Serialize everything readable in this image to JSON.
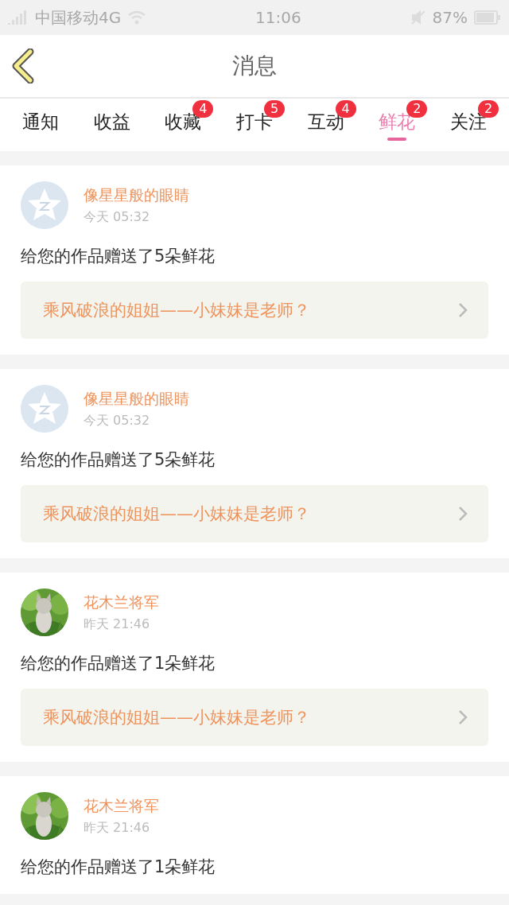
{
  "status_bar": {
    "carrier": "中国移动4G",
    "time": "11:06",
    "battery": "87%"
  },
  "header": {
    "title": "消息"
  },
  "tabs": [
    {
      "label": "通知",
      "selected": false
    },
    {
      "label": "收益",
      "selected": false
    },
    {
      "label": "收藏",
      "selected": false,
      "badge": "4"
    },
    {
      "label": "打卡",
      "selected": false,
      "badge": "5"
    },
    {
      "label": "互动",
      "selected": false,
      "badge": "4"
    },
    {
      "label": "鲜花",
      "selected": true,
      "badge": "2"
    },
    {
      "label": "关注",
      "selected": false,
      "badge": "2"
    }
  ],
  "messages": [
    {
      "kind": "default",
      "name": "像星星般的眼睛",
      "time": "今天 05:32",
      "text": "给您的作品赠送了5朵鲜花",
      "link": "乘风破浪的姐姐——小妹妹是老师？"
    },
    {
      "kind": "default",
      "name": "像星星般的眼睛",
      "time": "今天 05:32",
      "text": "给您的作品赠送了5朵鲜花",
      "link": "乘风破浪的姐姐——小妹妹是老师？"
    },
    {
      "kind": "picture",
      "name": "花木兰将军",
      "time": "昨天 21:46",
      "text": "给您的作品赠送了1朵鲜花",
      "link": "乘风破浪的姐姐——小妹妹是老师？"
    },
    {
      "kind": "picture",
      "name": "花木兰将军",
      "time": "昨天 21:46",
      "text": "给您的作品赠送了1朵鲜花"
    }
  ]
}
